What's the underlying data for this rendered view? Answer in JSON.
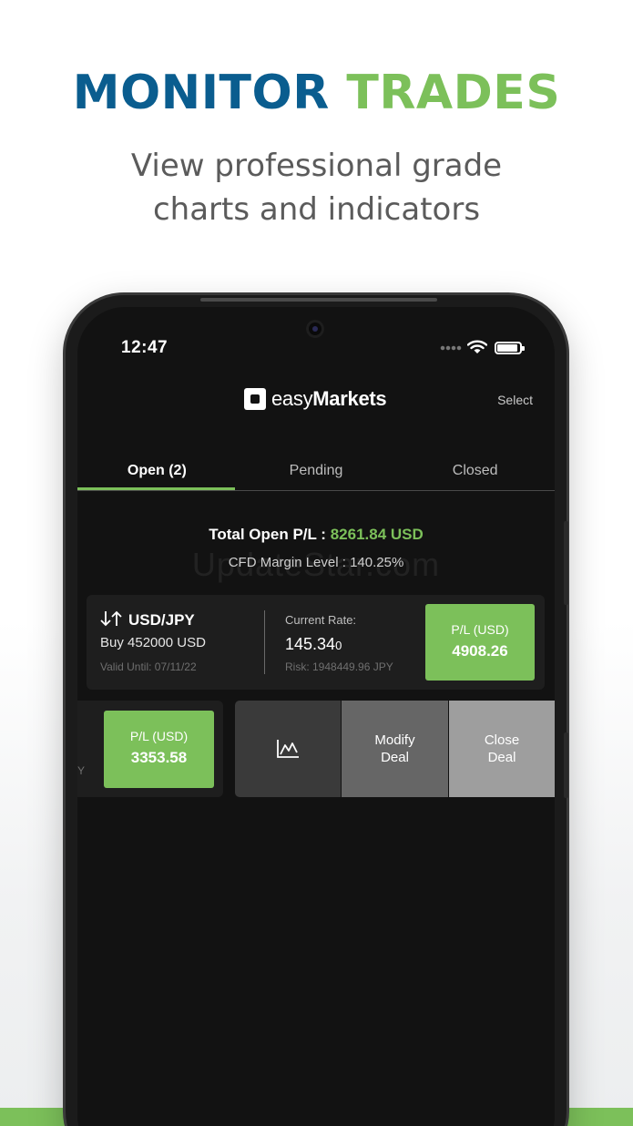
{
  "headline": {
    "word1": "MONITOR",
    "word2": "TRADES"
  },
  "subline": {
    "line1": "View professional grade",
    "line2": "charts and indicators"
  },
  "status_bar": {
    "time": "12:47"
  },
  "app": {
    "logo_text_part1": "easy",
    "logo_text_part2": "Markets",
    "select_label": "Select"
  },
  "tabs": [
    {
      "label": "Open (2)",
      "active": true
    },
    {
      "label": "Pending",
      "active": false
    },
    {
      "label": "Closed",
      "active": false
    }
  ],
  "summary": {
    "total_label": "Total Open P/L : ",
    "total_value": "8261.84 USD",
    "margin_level": "CFD Margin Level : 140.25%"
  },
  "watermark": "UpdateStar.com",
  "trades": [
    {
      "pair": "USD/JPY",
      "direction_amount": "Buy 452000 USD",
      "valid_until": "Valid Until: 07/11/22",
      "rate_label": "Current Rate:",
      "rate_main": "145.34",
      "rate_sub": "0",
      "risk": "Risk: 1948449.96 JPY",
      "pl_label": "P/L (USD)",
      "pl_value": "4908.26"
    },
    {
      "hint": "Y",
      "pl_label": "P/L (USD)",
      "pl_value": "3353.58"
    }
  ],
  "swipe_actions": {
    "modify_line1": "Modify",
    "modify_line2": "Deal",
    "close_line1": "Close",
    "close_line2": "Deal"
  },
  "colors": {
    "brand_blue": "#0a5d8f",
    "brand_green": "#7cc05a",
    "screen_bg": "#121212"
  }
}
